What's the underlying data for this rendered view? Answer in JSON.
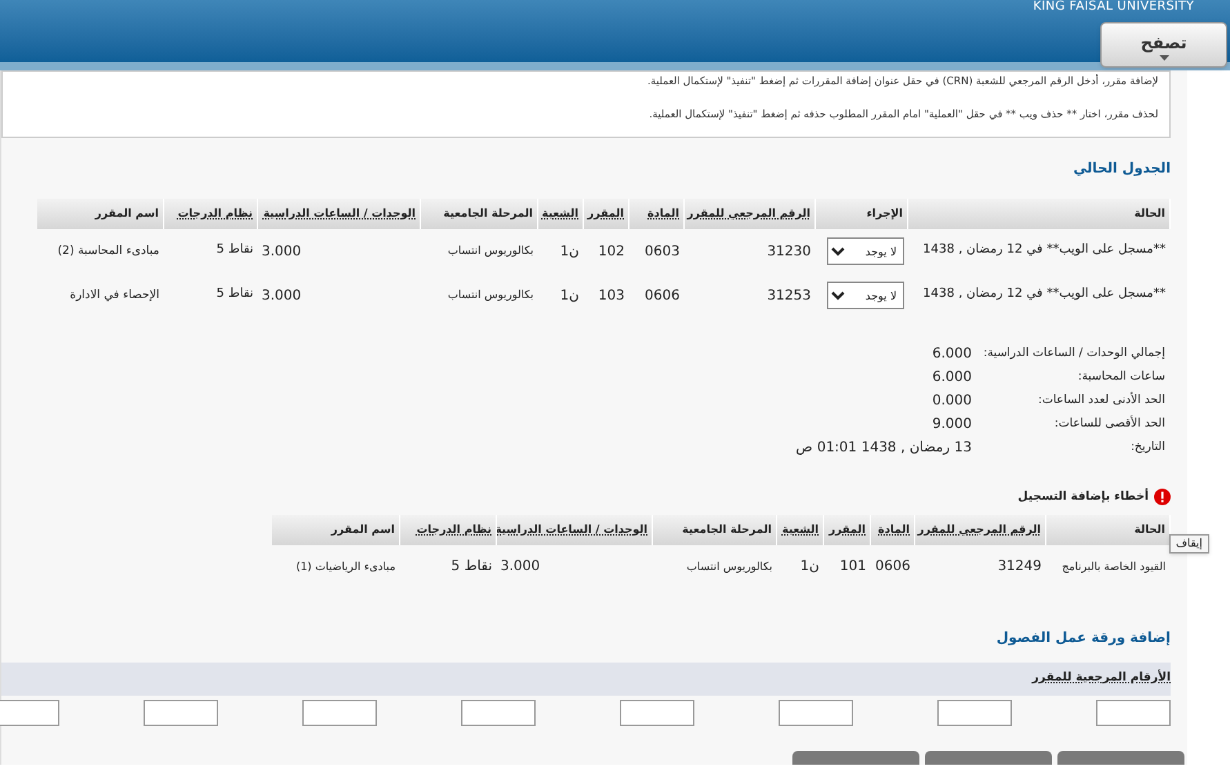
{
  "header": {
    "university": "KING FAISAL UNIVERSITY",
    "browse_button": "تصفح"
  },
  "instructions": [
    "لإضافة مقرر، أدخل الرقم المرجعي للشعبة (CRN) في حقل عنوان إضافة المقررات ثم إضغط \"تنفيذ\" لإستكمال العملية.",
    "لحذف مقرر، اختار ** حذف ويب ** في حقل \"العملية\" امام المقرر المطلوب حذفه ثم إضغط \"تنفيذ\" لإستكمال العملية."
  ],
  "current_schedule": {
    "title": "الجدول الحالي",
    "columns": [
      {
        "label": "الحالة",
        "sortable": false
      },
      {
        "label": "الإجراء",
        "sortable": false
      },
      {
        "label": "الرقم المرجعي للمقرر",
        "sortable": true
      },
      {
        "label": "المادة",
        "sortable": true
      },
      {
        "label": "المقرر",
        "sortable": true
      },
      {
        "label": "الشعبة",
        "sortable": true
      },
      {
        "label": "المرحلة الجامعية",
        "sortable": false
      },
      {
        "label": "الوحدات / الساعات الدراسية",
        "sortable": true
      },
      {
        "label": "نظام الدرجات",
        "sortable": true
      },
      {
        "label": "اسم المقرر",
        "sortable": false
      }
    ],
    "rows": [
      {
        "status": "**مسجل على الويب** في 12 رمضان , 1438",
        "action": "لا يوجد",
        "crn": "31230",
        "subject": "0603",
        "course": "102",
        "section": "ن1",
        "level": "بكالوريوس انتساب",
        "hours": "3.000",
        "grading": "نقاط 5",
        "title": "مبادىء المحاسبة (2)"
      },
      {
        "status": "**مسجل على الويب** في 12 رمضان , 1438",
        "action": "لا يوجد",
        "crn": "31253",
        "subject": "0606",
        "course": "103",
        "section": "ن1",
        "level": "بكالوريوس انتساب",
        "hours": "3.000",
        "grading": "نقاط 5",
        "title": "الإحصاء في الادارة"
      }
    ]
  },
  "summary": [
    {
      "label": "إجمالي الوحدات / الساعات الدراسية:",
      "value": "6.000"
    },
    {
      "label": "ساعات المحاسبة:",
      "value": "6.000"
    },
    {
      "label": "الحد الأدنى لعدد الساعات:",
      "value": "0.000"
    },
    {
      "label": "الحد الأقصى للساعات:",
      "value": "9.000"
    },
    {
      "label": "التاريخ:",
      "value": "13 رمضان , 1438 01:01 ص"
    }
  ],
  "errors": {
    "title": "أخطاء بإضافة التسجيل",
    "tooltip": "إيقاف",
    "columns": [
      {
        "label": "الحالة",
        "sortable": false
      },
      {
        "label": "الرقم المرجعي للمقرر",
        "sortable": true
      },
      {
        "label": "المادة",
        "sortable": true
      },
      {
        "label": "المقرر",
        "sortable": true
      },
      {
        "label": "الشعبة",
        "sortable": true
      },
      {
        "label": "المرحلة الجامعية",
        "sortable": false
      },
      {
        "label": "الوحدات / الساعات الدراسية",
        "sortable": true
      },
      {
        "label": "نظام الدرجات",
        "sortable": true
      },
      {
        "label": "اسم المقرر",
        "sortable": false
      }
    ],
    "rows": [
      [
        "القيود الخاصة بالبرنامج",
        "31249",
        "0606",
        "101",
        "ن1",
        "بكالوريوس انتساب",
        "3.000",
        "نقاط 5",
        "مبادىء الرياضيات (1)"
      ]
    ]
  },
  "add_worksheet": {
    "title": "إضافة ورقة عمل الفصول",
    "label": "الأرقام المرجعية للمقرر"
  }
}
